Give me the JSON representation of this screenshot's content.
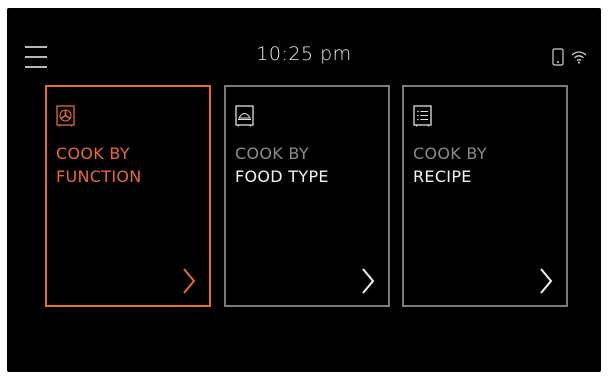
{
  "header": {
    "time": "10:25 pm",
    "icons": {
      "menu": "hamburger-menu-icon",
      "phone": "phone-icon",
      "wifi": "wifi-icon"
    }
  },
  "cards": [
    {
      "line1": "COOK BY",
      "line2": "FUNCTION",
      "icon": "fan-function-icon",
      "selected": true
    },
    {
      "line1": "COOK BY",
      "line2": "FOOD TYPE",
      "icon": "food-type-icon",
      "selected": false
    },
    {
      "line1": "COOK BY",
      "line2": "RECIPE",
      "icon": "recipe-list-icon",
      "selected": false
    }
  ],
  "colors": {
    "accent": "#e76b2d",
    "background": "#000000",
    "card_border": "#7a7a7a",
    "text": "#f2f2f2",
    "muted": "#8a8a8a"
  }
}
